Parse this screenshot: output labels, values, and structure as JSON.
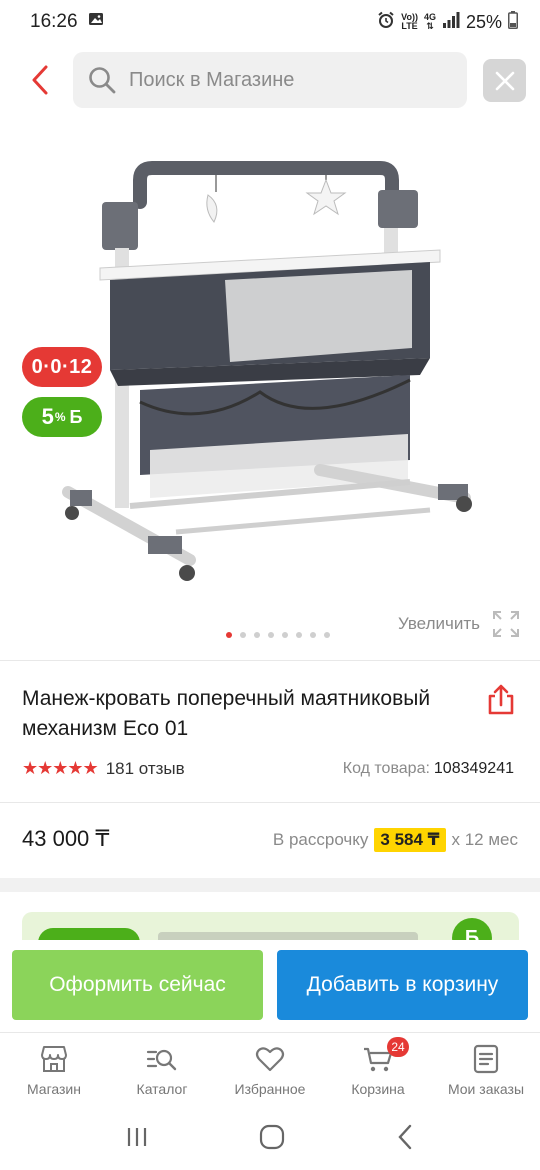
{
  "status_bar": {
    "time": "16:26",
    "volte_line1": "Vo))",
    "volte_line2": "LTE",
    "network": "4G",
    "battery": "25%"
  },
  "search": {
    "placeholder": "Поиск в Магазине"
  },
  "gallery": {
    "badge_installment": "0·0·12",
    "badge_bonus_value": "5",
    "badge_bonus_percent": "%",
    "badge_bonus_currency": "Б",
    "dots_total": 8,
    "active_dot": 0,
    "zoom_label": "Увеличить"
  },
  "product": {
    "title": "Манеж-кровать поперечный маятниковый механизм Eco 01",
    "rating_stars": "★★★★★",
    "reviews": "181 отзыв",
    "sku_label": "Код товара:",
    "sku_value": "108349241",
    "price": "43 000 ₸",
    "installment_prefix": "В рассрочку",
    "installment_amount": "3 584 ₸",
    "installment_suffix": "x 12 мес"
  },
  "actions": {
    "buy_now": "Оформить сейчас",
    "add_to_cart": "Добавить в корзину"
  },
  "bottom_nav": {
    "items": [
      {
        "label": "Магазин",
        "icon": "shop-icon"
      },
      {
        "label": "Каталог",
        "icon": "catalog-icon"
      },
      {
        "label": "Избранное",
        "icon": "heart-icon"
      },
      {
        "label": "Корзина",
        "icon": "cart-icon"
      },
      {
        "label": "Мои заказы",
        "icon": "orders-icon"
      }
    ],
    "cart_count": "24"
  },
  "colors": {
    "accent_red": "#e53935",
    "bonus_green": "#4caf1a",
    "buy_green": "#8bd45a",
    "cart_blue": "#1a8adb",
    "highlight_yellow": "#ffd400"
  }
}
